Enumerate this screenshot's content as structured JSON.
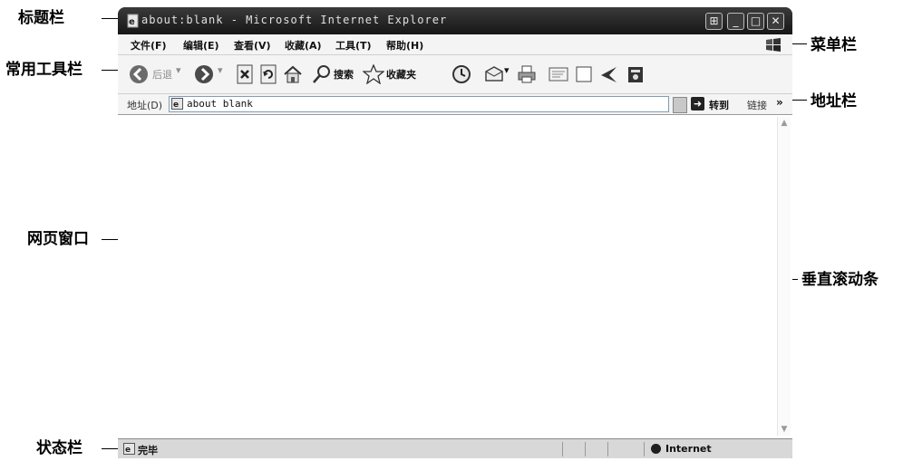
{
  "callouts": {
    "title_bar": "标题栏",
    "standard_toolbar": "常用工具栏",
    "web_window": "网页窗口",
    "status_bar": "状态栏",
    "menu_bar": "菜单栏",
    "address_bar": "地址栏",
    "vertical_scrollbar": "垂直滚动条"
  },
  "window": {
    "title": "about:blank - Microsoft Internet Explorer"
  },
  "menu": {
    "items": [
      {
        "label": "文件(F)"
      },
      {
        "label": "编辑(E)"
      },
      {
        "label": "查看(V)"
      },
      {
        "label": "收藏(A)"
      },
      {
        "label": "工具(T)"
      },
      {
        "label": "帮助(H)"
      }
    ]
  },
  "toolbar": {
    "back_label": "后退",
    "search_label": "搜索",
    "favorites_label": "收藏夹"
  },
  "address": {
    "label": "地址(D)",
    "value": "about blank",
    "go_label": "转到",
    "links_label": "链接",
    "links_chevron": "»"
  },
  "status": {
    "text": "完毕",
    "zone": "Internet"
  }
}
